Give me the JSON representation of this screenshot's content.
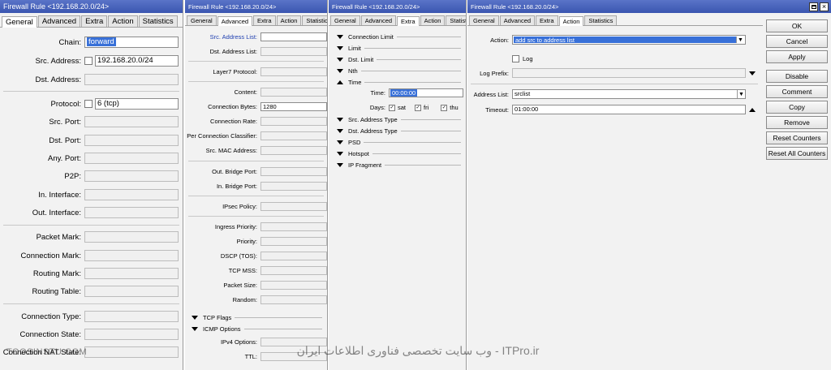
{
  "window_title": "Firewall Rule <192.168.20.0/24>",
  "tabs_main": [
    "General",
    "Advanced",
    "Extra",
    "Action",
    "Statistics"
  ],
  "general": {
    "chain_label": "Chain:",
    "chain_value": "forward",
    "src_address_label": "Src. Address:",
    "src_address_value": "192.168.20.0/24",
    "dst_address_label": "Dst. Address:",
    "protocol_label": "Protocol:",
    "protocol_value": "6 (tcp)",
    "src_port_label": "Src. Port:",
    "dst_port_label": "Dst. Port:",
    "any_port_label": "Any. Port:",
    "p2p_label": "P2P:",
    "in_interface_label": "In. Interface:",
    "out_interface_label": "Out. Interface:",
    "packet_mark_label": "Packet Mark:",
    "connection_mark_label": "Connection Mark:",
    "routing_mark_label": "Routing Mark:",
    "routing_table_label": "Routing Table:",
    "connection_type_label": "Connection Type:",
    "connection_state_label": "Connection State:",
    "connection_nat_label": "Connection NAT State:"
  },
  "advanced": {
    "src_address_list": "Src. Address List:",
    "dst_address_list": "Dst. Address List:",
    "layer7": "Layer7 Protocol:",
    "content": "Content:",
    "conn_bytes": "Connection Bytes:",
    "conn_bytes_value": "1280",
    "conn_rate": "Connection Rate:",
    "per_conn_classifier": "Per Connection Classifier:",
    "src_mac": "Src. MAC Address:",
    "out_bridge_port": "Out. Bridge Port:",
    "in_bridge_port": "In. Bridge Port:",
    "ipsec_policy": "IPsec Policy:",
    "ingress_priority": "Ingress Priority:",
    "priority": "Priority:",
    "dscp": "DSCP (TOS):",
    "tcp_mss": "TCP MSS:",
    "packet_size": "Packet Size:",
    "random": "Random:",
    "tcp_flags": "TCP Flags",
    "icmp_options": "ICMP Options",
    "ipv4_options": "IPv4 Options:",
    "ttl": "TTL:"
  },
  "extra": {
    "connection_limit": "Connection Limit",
    "limit": "Limit",
    "dst_limit": "Dst. Limit",
    "nth": "Nth",
    "time": "Time",
    "time_label": "Time:",
    "time_value": "00:00:00",
    "days_label": "Days:",
    "day1": "sat",
    "day2": "fri",
    "day3": "thu",
    "src_address_type": "Src. Address Type",
    "dst_address_type": "Dst. Address Type",
    "psd": "PSD",
    "hotspot": "Hotspot",
    "ip_fragment": "IP Fragment"
  },
  "action": {
    "action_label": "Action:",
    "action_value": "add src to address list",
    "log_label": "Log",
    "log_prefix_label": "Log Prefix:",
    "address_list_label": "Address List:",
    "address_list_value": "srclist",
    "timeout_label": "Timeout:",
    "timeout_value": "01:00:00"
  },
  "buttons": [
    "OK",
    "Cancel",
    "Apply",
    "Disable",
    "Comment",
    "Copy",
    "Remove",
    "Reset Counters",
    "Reset All Counters"
  ],
  "watermark_left": "TOOSINSTU.COM",
  "watermark_right": "ITPro.ir - وب سایت تخصصی فناوری اطلاعات ایران",
  "colors": {
    "titlebar": "#3a55b0",
    "selection": "#3870d8",
    "panel_bg": "#f2f2f2"
  }
}
